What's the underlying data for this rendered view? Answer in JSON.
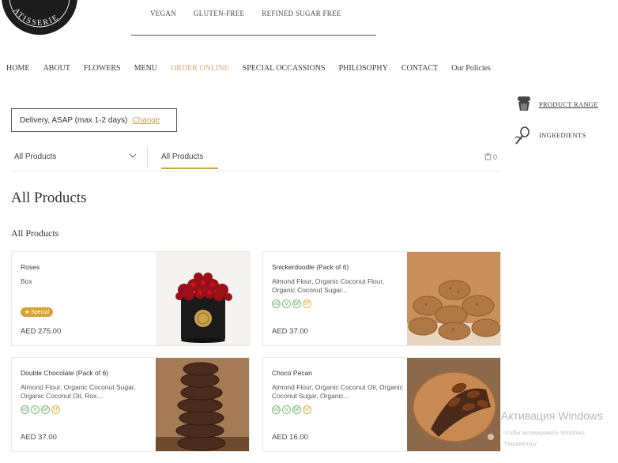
{
  "tagline": [
    "VEGAN",
    "GLUTEN-FREE",
    "REFINED SUGAR FREE"
  ],
  "nav": [
    "HOME",
    "ABOUT",
    "FLOWERS",
    "MENU",
    "ORDER ONLINE",
    "SPECIAL OCCASSIONS",
    "PHILOSOPHY",
    "CONTACT",
    "Our Policies"
  ],
  "nav_active": "ORDER ONLINE",
  "delivery": {
    "text": "Delivery, ASAP (max 1-2 days)",
    "change": "Change"
  },
  "side_links": {
    "product_range": "PRODUCT RANGE",
    "ingredients": "INGREDIENTS"
  },
  "filter": {
    "dropdown_value": "All Products",
    "tab": "All Products",
    "cart_count": "0"
  },
  "page_title": "All Products",
  "section_title": "All Products",
  "products": [
    {
      "name": "Roses",
      "desc": "Box",
      "price": "AED 275.00",
      "special": "★ Special",
      "badges": []
    },
    {
      "name": "Snickerdoodle (Pack of 6)",
      "desc": "Almond Flour, Organic Coconut Flour, Organic Coconut Sugar...",
      "price": "AED 37.00",
      "badges": [
        "VG",
        "V",
        "GF",
        "SF"
      ]
    },
    {
      "name": "Double Chocolate (Pack of 6)",
      "desc": "Almond Flour, Organic Coconut Sugar, Organic Coconut Oil, Rox...",
      "price": "AED 37.00",
      "badges": [
        "VG",
        "V",
        "GF",
        "SF"
      ]
    },
    {
      "name": "Choco Pecan",
      "desc": "Almond Flour, Organic Coconut Oil, Organic Coconut Sugar, Organic...",
      "price": "AED 16.00",
      "badges": [
        "VG",
        "V",
        "GF",
        "SF"
      ]
    }
  ],
  "watermark": {
    "title": "Активация Windows",
    "sub1": "Чтобы активировать Windows,",
    "sub2": "\"Параметры\"."
  },
  "colors": {
    "accent": "#c9a24a",
    "nav_active": "#d8a878",
    "special": "#d7a335"
  }
}
